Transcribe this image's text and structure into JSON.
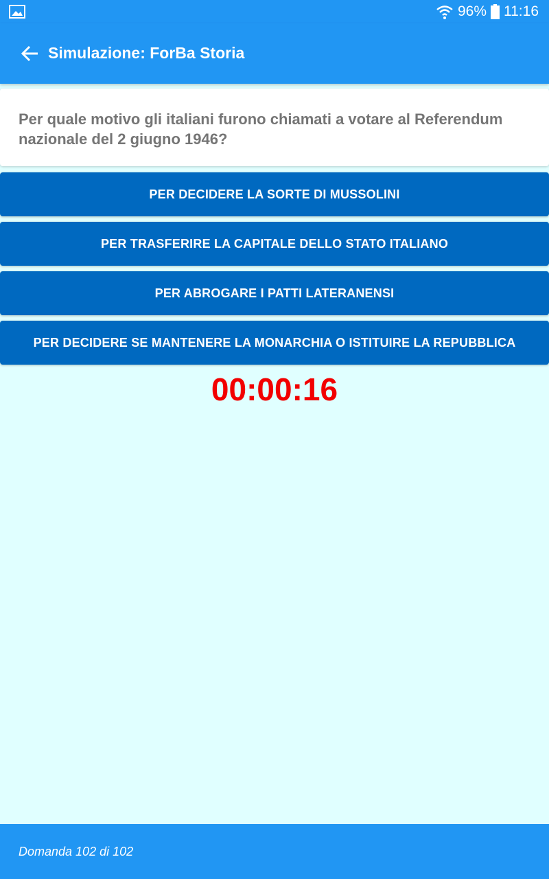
{
  "status_bar": {
    "battery": "96%",
    "time": "11:16",
    "icons": [
      "gallery-icon",
      "wifi-icon",
      "battery-icon"
    ]
  },
  "app_bar": {
    "title": "Simulazione: ForBa Storia",
    "back_icon": "arrow-left-icon"
  },
  "question": {
    "text": "Per quale motivo gli italiani furono chiamati a votare al Referendum nazionale del 2 giugno 1946?"
  },
  "answers": [
    "PER DECIDERE LA SORTE DI MUSSOLINI",
    "PER TRASFERIRE LA CAPITALE DELLO STATO ITALIANO",
    "PER ABROGARE I PATTI LATERANENSI",
    "PER DECIDERE SE MANTENERE LA MONARCHIA O ISTITUIRE LA REPUBBLICA"
  ],
  "timer": "00:00:16",
  "footer": {
    "counter": "Domanda 102 di 102"
  },
  "colors": {
    "primary": "#2196f3",
    "answer_button": "#0069c0",
    "background": "#e0ffff",
    "timer": "#f20000",
    "question_text": "#757575"
  }
}
